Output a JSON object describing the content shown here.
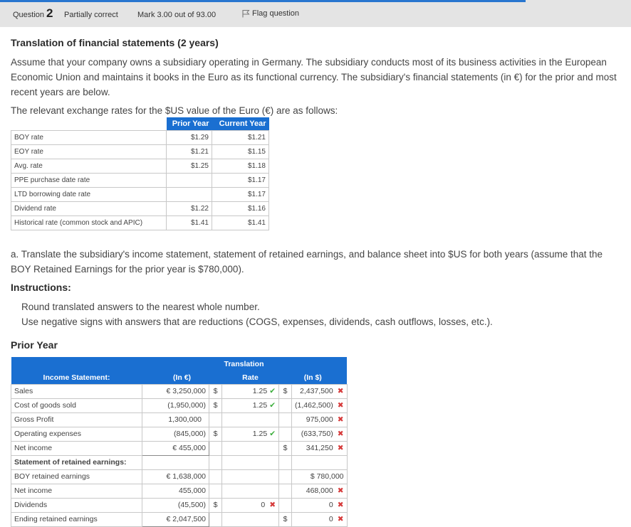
{
  "header": {
    "question_label": "Question",
    "question_number": "2",
    "state": "Partially correct",
    "mark": "Mark 3.00 out of 93.00",
    "flag": "Flag question"
  },
  "question": {
    "title": "Translation of financial statements (2 years)",
    "intro": "Assume that your company owns a subsidiary operating in Germany. The subsidiary conducts most of its business activities in the European Economic Union and maintains it books in the Euro as its functional currency. The subsidiary's financial statements (in €) for the prior and most recent years are below.",
    "rates_intro": "The relevant exchange rates for the $US value of the Euro (€) are as follows:"
  },
  "rates": {
    "headers": [
      "Prior Year",
      "Current Year"
    ],
    "rows": [
      {
        "label": "BOY rate",
        "prior": "$1.29",
        "current": "$1.21"
      },
      {
        "label": "EOY rate",
        "prior": "$1.21",
        "current": "$1.15"
      },
      {
        "label": "Avg. rate",
        "prior": "$1.25",
        "current": "$1.18"
      },
      {
        "label": "PPE purchase date rate",
        "prior": "",
        "current": "$1.17"
      },
      {
        "label": "LTD borrowing date rate",
        "prior": "",
        "current": "$1.17"
      },
      {
        "label": "Dividend rate",
        "prior": "$1.22",
        "current": "$1.16"
      },
      {
        "label": "Historical rate (common stock and APIC)",
        "prior": "$1.41",
        "current": "$1.41"
      }
    ]
  },
  "part_a": {
    "text": "a. Translate the subsidiary's income statement, statement of retained earnings, and balance sheet into $US for both years (assume that the BOY Retained Earnings for the prior year is $780,000).",
    "instructions_label": "Instructions:",
    "instruction_1": "Round translated answers to the nearest whole number.",
    "instruction_2": "Use negative signs with answers that are reductions (COGS, expenses, dividends, cash outflows, losses, etc.).",
    "prior_year_label": "Prior Year"
  },
  "income": {
    "header_translation": "Translation",
    "header_income": "Income Statement:",
    "header_euro": "(In €)",
    "header_rate": "Rate",
    "header_usd": "(In $)",
    "rows": [
      {
        "label": "Sales",
        "euro": "€ 3,250,000",
        "ds": "$",
        "rate": "1.25",
        "d2": "$",
        "usd": "2,437,500"
      },
      {
        "label": "Cost of goods sold",
        "euro": "(1,950,000)",
        "ds": "$",
        "rate": "1.25",
        "d2": "",
        "usd": "(1,462,500)"
      },
      {
        "label": "Gross Profit",
        "euro": "1,300,000",
        "ds": "",
        "rate": "",
        "d2": "",
        "usd": "975,000"
      },
      {
        "label": "Operating expenses",
        "euro": "(845,000)",
        "ds": "$",
        "rate": "1.25",
        "d2": "",
        "usd": "(633,750)"
      },
      {
        "label": "Net income",
        "euro": "€ 455,000",
        "ds": "",
        "rate": "",
        "d2": "$",
        "usd": "341,250"
      }
    ],
    "retained_header": "Statement of retained earnings:",
    "retained_rows": [
      {
        "label": "BOY retained earnings",
        "euro": "€ 1,638,000",
        "ds": "",
        "rate": "",
        "d2": "",
        "usd": "$ 780,000"
      },
      {
        "label": "Net income",
        "euro": "455,000",
        "ds": "",
        "rate": "",
        "d2": "",
        "usd": "468,000"
      },
      {
        "label": "Dividends",
        "euro": "(45,500)",
        "ds": "$",
        "rate": "0",
        "d2": "",
        "usd": "0"
      },
      {
        "label": "Ending retained earnings",
        "euro": "€ 2,047,500",
        "ds": "",
        "rate": "",
        "d2": "$",
        "usd": "0"
      }
    ]
  },
  "marks": {
    "correct": "✔",
    "incorrect": "✖"
  },
  "colors": {
    "accent": "#1a6fd1",
    "correct": "#3cae3c",
    "incorrect": "#d63a3a",
    "header_bg": "#e4e4e4"
  }
}
